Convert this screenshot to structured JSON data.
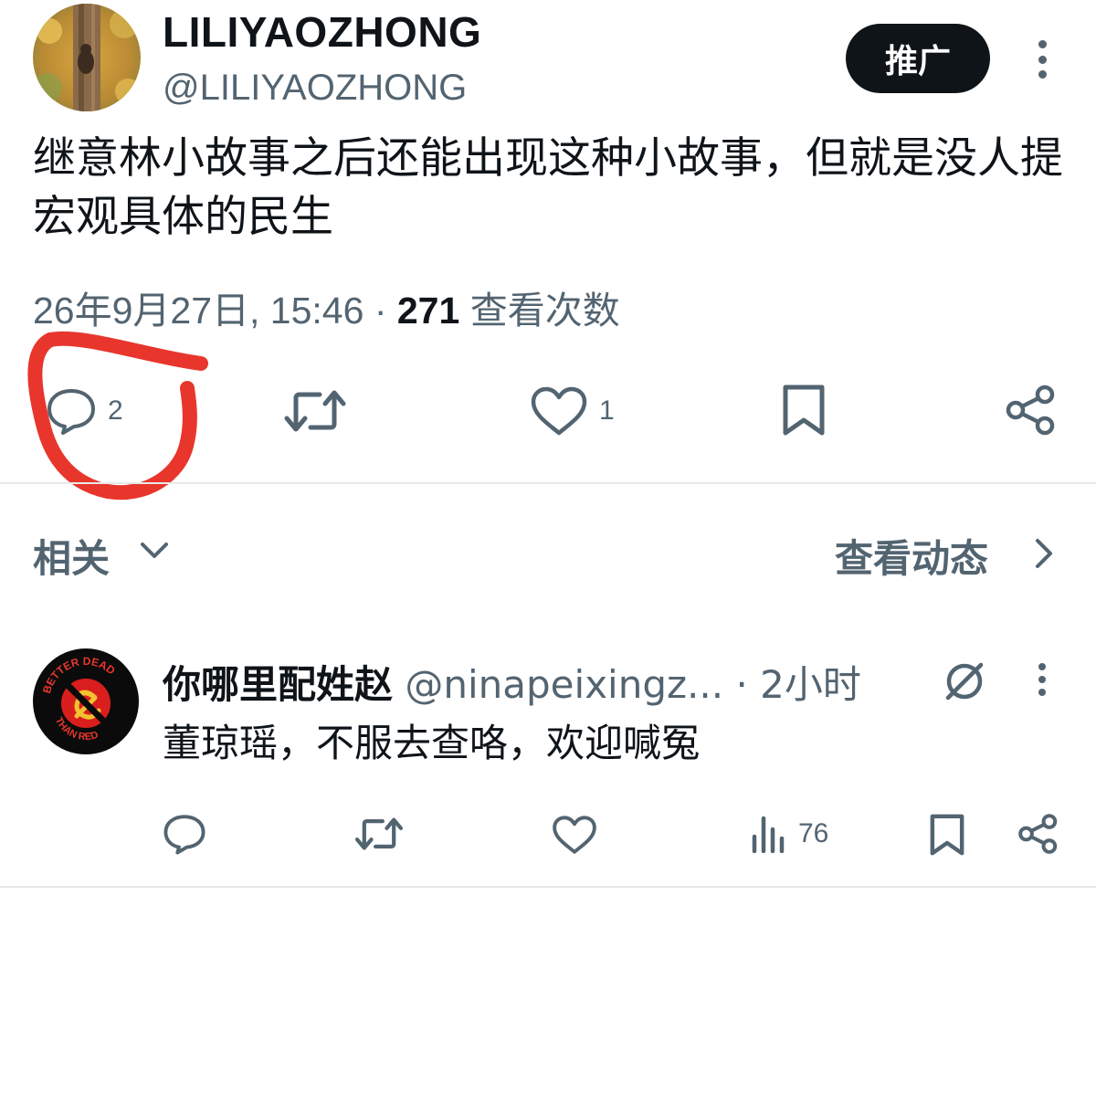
{
  "main_tweet": {
    "display_name": "LILIYAOZHONG",
    "handle": "@LILIYAOZHONG",
    "promoted_label": "推广",
    "text": "继意林小故事之后还能出现这种小故事，但就是没人提宏观具体的民生",
    "timestamp": "26年9月27日, 15:46",
    "separator": "·",
    "views_count": "271",
    "views_label": "查看次数",
    "actions": {
      "reply_count": "2",
      "like_count": "1"
    },
    "icons": [
      "reply-icon",
      "retweet-icon",
      "like-icon",
      "bookmark-icon",
      "share-icon",
      "more-vertical-icon"
    ]
  },
  "related_bar": {
    "label": "相关",
    "view_activity_label": "查看动态"
  },
  "reply_tweet": {
    "display_name": "你哪里配姓赵",
    "handle": "@ninapeixingz...",
    "time": "· 2小时",
    "text": "董琼瑶，不服去查咯，欢迎喊冤",
    "views_count": "76",
    "avatar_text_top": "BETTER DEAD",
    "avatar_text_bottom": "THAN RED",
    "icons": [
      "reply-icon",
      "retweet-icon",
      "like-icon",
      "views-icon",
      "bookmark-icon",
      "share-icon",
      "grok-icon",
      "more-vertical-icon"
    ]
  },
  "colors": {
    "text_primary": "#0f1419",
    "text_secondary": "#536471",
    "divider": "#e7e9ea",
    "annotation_red": "#e8362d"
  }
}
